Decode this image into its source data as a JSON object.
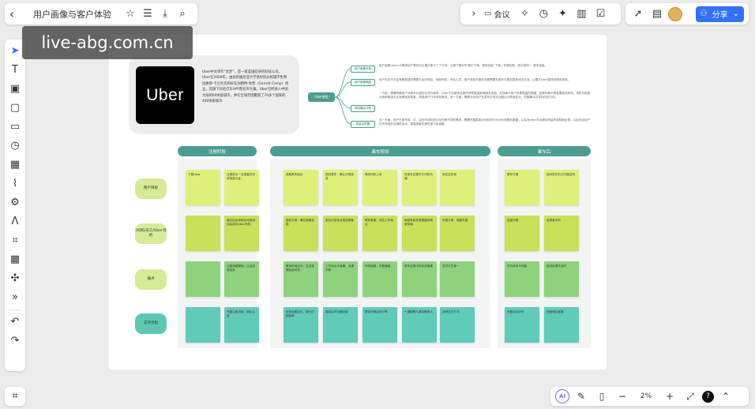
{
  "window": {
    "doc_title": "用户画像与客户体验"
  },
  "toolbar_mid": {
    "meeting_label": "会议"
  },
  "toolbar_right": {
    "share_label": "分享"
  },
  "watermark": "live-abg.com.cn",
  "intro": {
    "logo_text": "Uber",
    "description": "Uber中文译作“优步”，是一家美国硅谷的科技公司。Uber在2009年，由加利福尼亚大学洛杉矶分校辍学生特拉维斯·卡兰尼克和好友加勒特·坎普（Garrett Camp）创立。因旗下同名打车APP而名声大噪。Uber已经进入中国大陆的60余座城市，并在全球范围覆盖了70多个国家的400余座城市"
  },
  "mindmap": {
    "root": "Uber旅程",
    "nodes": [
      "用户画像分析",
      "用户旅程映射",
      "体验痛点分析",
      "机会点挖掘"
    ],
    "descriptions": [
      "用户画像(User)与需求用户群体为主要对象于三个方向：注册下载APP/预约下单，服务结束“下单、车辆匹配，到达现场”，乘车结束。",
      "用户在出行中会有着很强的需要与及时响应，驾驶司机，开后人员，用户体验与服务流程需要在乘车中更加整体地去交流，让模式Uber整体的服务体验。",
      "一方面，需要明确用户对服务价值的认知与使用，Uber平台整体运营的效率直接影响服务体验，在场景中用户有着更高的期望，如果场景中乘客要找到司机，司机可能因为各种原因无法准确找到乘客，导致用户打车体验降低。另一方面，需要分析用户在乘车中的交互触点与情绪变化，挖掘痛点并寻找改进方向。",
      "另一方面，用户在乘车前、中、后的不同阶段中存在着不同的需求，需要挖掘乘客对司机的行为评价和服务期望，以及对Uber平台服务质量的感知和反馈，以此找出用户打车体验的关键机会点，提高乘客的满意度与忠诚度。"
    ]
  },
  "phases": [
    "注册阶段",
    "乘车阶段",
    "乘车后"
  ],
  "rows": [
    "用户目标",
    "(司机)员工/Uber司机",
    "痛点",
    "支持流程"
  ],
  "notes": {
    "row1": [
      "下载Uber",
      "注册成为一名乘客并完成信息认证...",
      "选取乘车起点",
      "预约乘车，确认行程信息",
      "等待司机上车",
      "在乘车过程中与司机沟通",
      "到达目的地",
      "乘车付费",
      "给司机评价与行程反馈"
    ],
    "row2": [
      "",
      "通过后台审核及司机培训后成为Uber司机",
      "接收订单，确认乘客信息",
      "前往约定地点接送乘客",
      "联系乘客，到达上车地点",
      "使用导航并根据路线驾驶车辆",
      "完成订单，收取车费",
      "结束行程",
      "给乘客评价"
    ],
    "row3": [
      "",
      "注册流程繁琐，认证信息较多",
      "等待时间过长，无法准确找到司机",
      "上车地点不准确，沟通不畅",
      "司机绕路，车费偏高",
      "乘车过程中的安全隐患",
      "支付方式单一",
      "评价体系不完善",
      "投诉处理不及时"
    ],
    "row4": [
      "",
      "完善注册流程，简化认证",
      "优化地图定位，提升匹配效率",
      "增加实时沟通功能",
      "提供行程实时分享",
      "一键报警与紧急联系人",
      "多种支付方式",
      "完善双向评价",
      "快速响应客服"
    ]
  },
  "zoom": {
    "level": "2%"
  }
}
